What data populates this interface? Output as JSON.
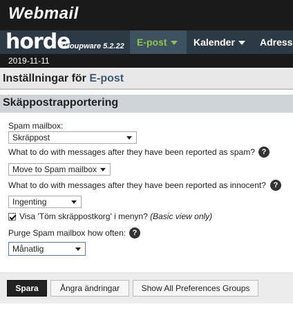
{
  "brand": {
    "logo": "Webmail"
  },
  "nav": {
    "horde": "horde",
    "groupware": "Groupware 5.2.22",
    "items": [
      {
        "label": "E-post",
        "active": true
      },
      {
        "label": "Kalender",
        "active": false
      },
      {
        "label": "Adressb",
        "active": false
      }
    ]
  },
  "date": "2019-11-11",
  "page": {
    "title_prefix": "Inställningar för",
    "title_module": "E-post"
  },
  "section": {
    "title": "Skäppostrapportering"
  },
  "form": {
    "spam_mailbox_label": "Spam mailbox:",
    "spam_mailbox_value": "Skräppost",
    "after_spam_label": "What to do with messages after they have been reported as spam?",
    "after_spam_value": "Move to Spam mailbox",
    "after_innocent_label": "What to do with messages after they have been reported as innocent?",
    "after_innocent_value": "Ingenting",
    "show_empty_label": "Visa 'Töm skräppostkorg' i menyn?",
    "show_empty_note": "(Basic view only)",
    "show_empty_checked": true,
    "purge_label": "Purge Spam mailbox how often:",
    "purge_value": "Månatlig",
    "help_glyph": "?"
  },
  "footer": {
    "save": "Spara",
    "undo": "Ångra ändringar",
    "show_all": "Show All Preferences Groups"
  },
  "colors": {
    "active_nav": "#8ec641",
    "navbar": "#2b3a45",
    "topbar": "#1a1a1a"
  }
}
